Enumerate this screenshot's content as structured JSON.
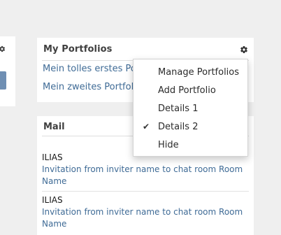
{
  "portfolios": {
    "title": "My Portfolios",
    "gear_icon": "gear-icon",
    "links": [
      "Mein tolles erstes Portfolio",
      "Mein zweites Portfolio"
    ]
  },
  "dropdown": {
    "items": [
      {
        "label": "Manage Portfolios",
        "checked": false
      },
      {
        "label": "Add Portfolio",
        "checked": false
      },
      {
        "label": "Details 1",
        "checked": false
      },
      {
        "label": "Details 2",
        "checked": true
      },
      {
        "label": "Hide",
        "checked": false
      }
    ],
    "check_icon": "✔"
  },
  "mail": {
    "title": "Mail",
    "items": [
      {
        "sender": "ILIAS",
        "subject": "Invitation from inviter name to chat room Room Name"
      },
      {
        "sender": "ILIAS",
        "subject": "Invitation from inviter name to chat room Room Name"
      }
    ]
  },
  "colors": {
    "link": "#3f6b96",
    "background": "#efefef",
    "panel": "#ffffff",
    "left_panel_accent": "#6f8fb3"
  }
}
